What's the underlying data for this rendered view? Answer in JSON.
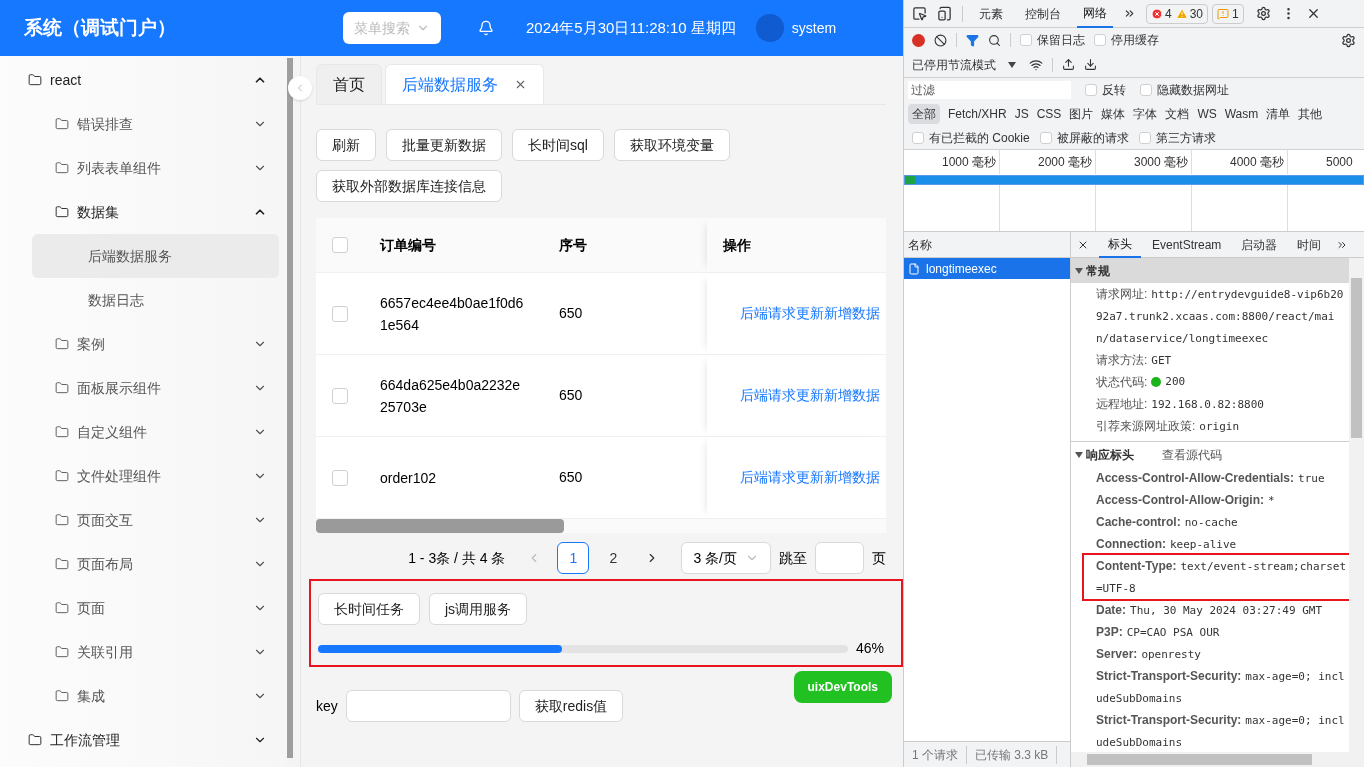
{
  "header": {
    "title": "系统（调试门户）",
    "search_placeholder": "菜单搜索",
    "datetime": "2024年5月30日11:28:10 星期四",
    "user": "system"
  },
  "sidebar": {
    "items": [
      {
        "label": "react",
        "expanded": true,
        "selected": false,
        "children": [
          {
            "label": "错误排查",
            "expanded": false,
            "selected": false
          },
          {
            "label": "列表表单组件",
            "expanded": false,
            "selected": false
          },
          {
            "label": "数据集",
            "expanded": true,
            "selected": false,
            "children": [
              {
                "label": "后端数据服务",
                "selected": true
              },
              {
                "label": "数据日志",
                "selected": false
              }
            ]
          },
          {
            "label": "案例",
            "expanded": false,
            "selected": false
          },
          {
            "label": "面板展示组件",
            "expanded": false,
            "selected": false
          },
          {
            "label": "自定义组件",
            "expanded": false,
            "selected": false
          },
          {
            "label": "文件处理组件",
            "expanded": false,
            "selected": false
          },
          {
            "label": "页面交互",
            "expanded": false,
            "selected": false
          },
          {
            "label": "页面布局",
            "expanded": false,
            "selected": false
          },
          {
            "label": "页面",
            "expanded": false,
            "selected": false
          },
          {
            "label": "关联引用",
            "expanded": false,
            "selected": false
          },
          {
            "label": "集成",
            "expanded": false,
            "selected": false
          }
        ]
      },
      {
        "label": "工作流管理",
        "expanded": false,
        "selected": false
      }
    ]
  },
  "tabs": [
    {
      "label": "首页",
      "selected": false,
      "closable": false
    },
    {
      "label": "后端数据服务",
      "selected": true,
      "closable": true
    }
  ],
  "actions": [
    "刷新",
    "批量更新数据",
    "长时间sql",
    "获取环境变量",
    "获取外部数据库连接信息"
  ],
  "table": {
    "header_checked": false,
    "columns": [
      "订单编号",
      "序号",
      "操作"
    ],
    "rows": [
      {
        "checked": false,
        "order_no": "6657ec4ee4b0ae1f0d61e564",
        "seq": "650",
        "action": "后端请求更新新增数据"
      },
      {
        "checked": false,
        "order_no": "664da625e4b0a2232e25703e",
        "seq": "650",
        "action": "后端请求更新新增数据"
      },
      {
        "checked": false,
        "order_no": "order102",
        "seq": "650",
        "action": "后端请求更新新增数据"
      }
    ]
  },
  "pagination": {
    "summary": "1 - 3条 / 共 4 条",
    "pages": [
      {
        "label": "1",
        "selected": true
      },
      {
        "label": "2",
        "selected": false
      }
    ],
    "page_size": "3 条/页",
    "jump_label": "跳至",
    "page_suffix": "页"
  },
  "task_panel": {
    "highlighted": true,
    "buttons": [
      "长时间任务",
      "js调用服务"
    ],
    "progress": {
      "level": 0.46,
      "reading": "46%"
    }
  },
  "redis": {
    "label": "key",
    "button": "获取redis值"
  },
  "float_button": "uixDevTools",
  "devtools": {
    "tabs": [
      {
        "label": "元素",
        "selected": false
      },
      {
        "label": "控制台",
        "selected": false
      },
      {
        "label": "网络",
        "selected": true
      }
    ],
    "errors": "4",
    "warnings": "30",
    "issues": "1",
    "recording": true,
    "preserve_log": {
      "label": "保留日志",
      "checked": false
    },
    "disable_cache": {
      "label": "停用缓存",
      "checked": false
    },
    "throttle": "已停用节流模式",
    "filter_placeholder": "过滤",
    "invert": {
      "label": "反转",
      "checked": false
    },
    "hide_data_urls": {
      "label": "隐藏数据网址",
      "checked": false
    },
    "type_filters": [
      {
        "label": "全部",
        "selected": true
      },
      {
        "label": "Fetch/XHR",
        "selected": false
      },
      {
        "label": "JS",
        "selected": false
      },
      {
        "label": "CSS",
        "selected": false
      },
      {
        "label": "图片",
        "selected": false
      },
      {
        "label": "媒体",
        "selected": false
      },
      {
        "label": "字体",
        "selected": false
      },
      {
        "label": "文档",
        "selected": false
      },
      {
        "label": "WS",
        "selected": false
      },
      {
        "label": "Wasm",
        "selected": false
      },
      {
        "label": "清单",
        "selected": false
      },
      {
        "label": "其他",
        "selected": false
      }
    ],
    "extra_filters": [
      {
        "label": "有已拦截的 Cookie",
        "checked": false
      },
      {
        "label": "被屏蔽的请求",
        "checked": false
      },
      {
        "label": "第三方请求",
        "checked": false
      }
    ],
    "timeline_ticks": [
      "1000 毫秒",
      "2000 毫秒",
      "3000 毫秒",
      "4000 毫秒",
      "5000"
    ],
    "list_header": "名称",
    "requests": [
      {
        "name": "longtimeexec",
        "selected": true
      }
    ],
    "detail_tabs": [
      {
        "label": "标头",
        "selected": true
      },
      {
        "label": "EventStream",
        "selected": false
      },
      {
        "label": "启动器",
        "selected": false
      },
      {
        "label": "时间",
        "selected": false
      }
    ],
    "general": {
      "title": "常规",
      "expanded": true,
      "rows": [
        {
          "kind": "text",
          "name": "请求网址:",
          "value": "http://entrydevguide8-vip6b2092a7.trunk2.xcaas.com:8800/react/main/dataservice/longtimeexec"
        },
        {
          "kind": "text",
          "name": "请求方法:",
          "value": "GET"
        },
        {
          "kind": "status",
          "name": "状态代码:",
          "value": "200"
        },
        {
          "kind": "text",
          "name": "远程地址:",
          "value": "192.168.0.82:8800"
        },
        {
          "kind": "text",
          "name": "引荐来源网址政策:",
          "value": "origin"
        }
      ]
    },
    "response_headers": {
      "title": "响应标头",
      "expanded": true,
      "source_link": "查看源代码",
      "rows": [
        {
          "name": "Access-Control-Allow-Credentials:",
          "value": "true",
          "highlighted": false
        },
        {
          "name": "Access-Control-Allow-Origin:",
          "value": "*",
          "highlighted": false
        },
        {
          "name": "Cache-control:",
          "value": "no-cache",
          "highlighted": false
        },
        {
          "name": "Connection:",
          "value": "keep-alive",
          "highlighted": false
        },
        {
          "name": "Content-Type:",
          "value": "text/event-stream;charset=UTF-8",
          "highlighted": true
        },
        {
          "name": "Date:",
          "value": "Thu, 30 May 2024 03:27:49 GMT",
          "highlighted": false
        },
        {
          "name": "P3P:",
          "value": "CP=CAO PSA OUR",
          "highlighted": false
        },
        {
          "name": "Server:",
          "value": "openresty",
          "highlighted": false
        },
        {
          "name": "Strict-Transport-Security:",
          "value": "max-age=0; includeSubDomains",
          "highlighted": false
        },
        {
          "name": "Strict-Transport-Security:",
          "value": "max-age=0; includeSubDomains",
          "highlighted": false
        }
      ]
    },
    "status_bar": [
      "1 个请求",
      "已传输 3.3 kB"
    ]
  }
}
